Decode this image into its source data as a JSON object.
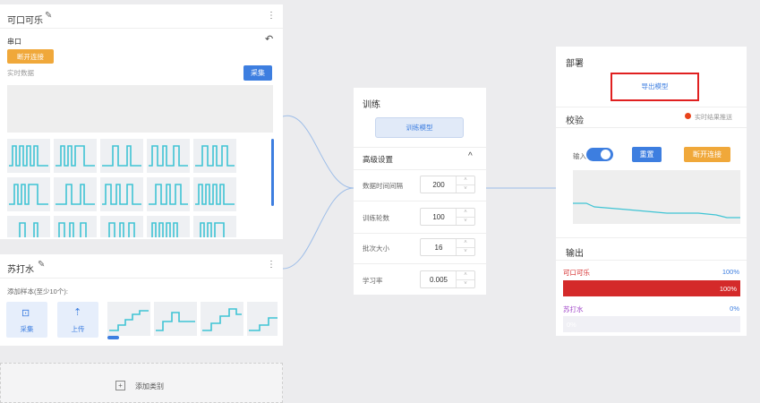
{
  "class1": {
    "name": "可口可乐",
    "serial_label": "串口",
    "disconnect_label": "断开连接",
    "realtime_label": "实时数据",
    "collect_label": "采集",
    "sample_count": 15
  },
  "class2": {
    "name": "苏打水",
    "add_samples_label": "添加样本(至少10个):",
    "collect_label": "采集",
    "upload_label": "上传",
    "sample_count": 4
  },
  "add_class_label": "添加类别",
  "train": {
    "title": "训练",
    "train_button": "训练模型",
    "advanced_label": "高级设置",
    "params": [
      {
        "label": "数据时间间隔",
        "value": "200"
      },
      {
        "label": "训练轮数",
        "value": "100"
      },
      {
        "label": "批次大小",
        "value": "16"
      },
      {
        "label": "学习率",
        "value": "0.005"
      }
    ]
  },
  "deploy": {
    "title": "部署",
    "export_button": "导出模型",
    "verify_title": "校验",
    "realtime_push_label": "实时结果推送",
    "input_label": "输入",
    "reset_label": "重置",
    "disconnect_label": "断开连接",
    "output_title": "输出",
    "outputs": [
      {
        "label": "可口可乐",
        "value": "100%",
        "fraction": 1.0
      },
      {
        "label": "苏打水",
        "value": "0%",
        "fraction": 0.0
      }
    ]
  },
  "colors": {
    "accent_blue": "#3d7ee0",
    "orange": "#f0a83a",
    "red": "#d42a2a",
    "purple": "#a046c8",
    "teal": "#3fc4d4"
  }
}
